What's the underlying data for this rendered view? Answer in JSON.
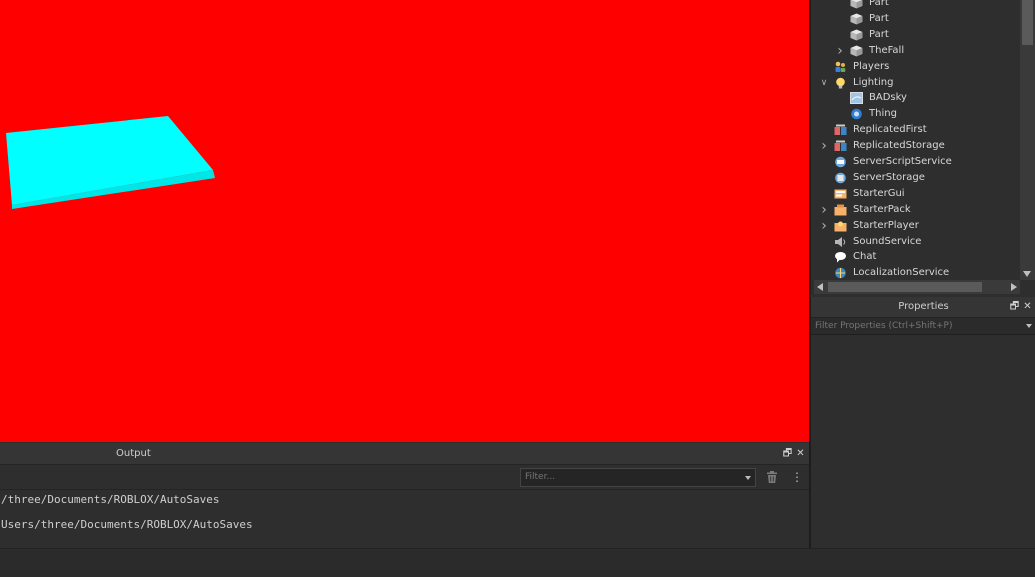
{
  "viewport": {
    "background_color": "#ff0000",
    "part_color": "#00ffff"
  },
  "explorer": {
    "items": [
      {
        "label": "Part",
        "icon": "part-icon",
        "expandable": false,
        "expanded": false,
        "indent": 2
      },
      {
        "label": "Part",
        "icon": "part-icon",
        "expandable": false,
        "expanded": false,
        "indent": 2
      },
      {
        "label": "Part",
        "icon": "part-icon",
        "expandable": false,
        "expanded": false,
        "indent": 2
      },
      {
        "label": "TheFall",
        "icon": "part-icon",
        "expandable": true,
        "expanded": false,
        "indent": 2
      },
      {
        "label": "Players",
        "icon": "players-icon",
        "expandable": false,
        "expanded": false,
        "indent": 1
      },
      {
        "label": "Lighting",
        "icon": "lighting-icon",
        "expandable": true,
        "expanded": true,
        "indent": 1
      },
      {
        "label": "BADsky",
        "icon": "sky-icon",
        "expandable": false,
        "expanded": false,
        "indent": 2
      },
      {
        "label": "Thing",
        "icon": "atmosphere-icon",
        "expandable": false,
        "expanded": false,
        "indent": 2
      },
      {
        "label": "ReplicatedFirst",
        "icon": "replicated-first-icon",
        "expandable": false,
        "expanded": false,
        "indent": 1
      },
      {
        "label": "ReplicatedStorage",
        "icon": "replicated-storage-icon",
        "expandable": true,
        "expanded": false,
        "indent": 1
      },
      {
        "label": "ServerScriptService",
        "icon": "server-script-service-icon",
        "expandable": false,
        "expanded": false,
        "indent": 1
      },
      {
        "label": "ServerStorage",
        "icon": "server-storage-icon",
        "expandable": false,
        "expanded": false,
        "indent": 1
      },
      {
        "label": "StarterGui",
        "icon": "starter-gui-icon",
        "expandable": false,
        "expanded": false,
        "indent": 1
      },
      {
        "label": "StarterPack",
        "icon": "starter-pack-icon",
        "expandable": true,
        "expanded": false,
        "indent": 1
      },
      {
        "label": "StarterPlayer",
        "icon": "starter-player-icon",
        "expandable": true,
        "expanded": false,
        "indent": 1
      },
      {
        "label": "SoundService",
        "icon": "sound-service-icon",
        "expandable": false,
        "expanded": false,
        "indent": 1
      },
      {
        "label": "Chat",
        "icon": "chat-icon",
        "expandable": false,
        "expanded": false,
        "indent": 1
      },
      {
        "label": "LocalizationService",
        "icon": "localization-service-icon",
        "expandable": false,
        "expanded": false,
        "indent": 1
      }
    ]
  },
  "properties": {
    "title": "Properties",
    "filter_placeholder": "Filter Properties (Ctrl+Shift+P)"
  },
  "output": {
    "title": "Output",
    "filter_placeholder": "Filter...",
    "lines": [
      "/three/Documents/ROBLOX/AutoSaves",
      "Users/three/Documents/ROBLOX/AutoSaves"
    ]
  }
}
